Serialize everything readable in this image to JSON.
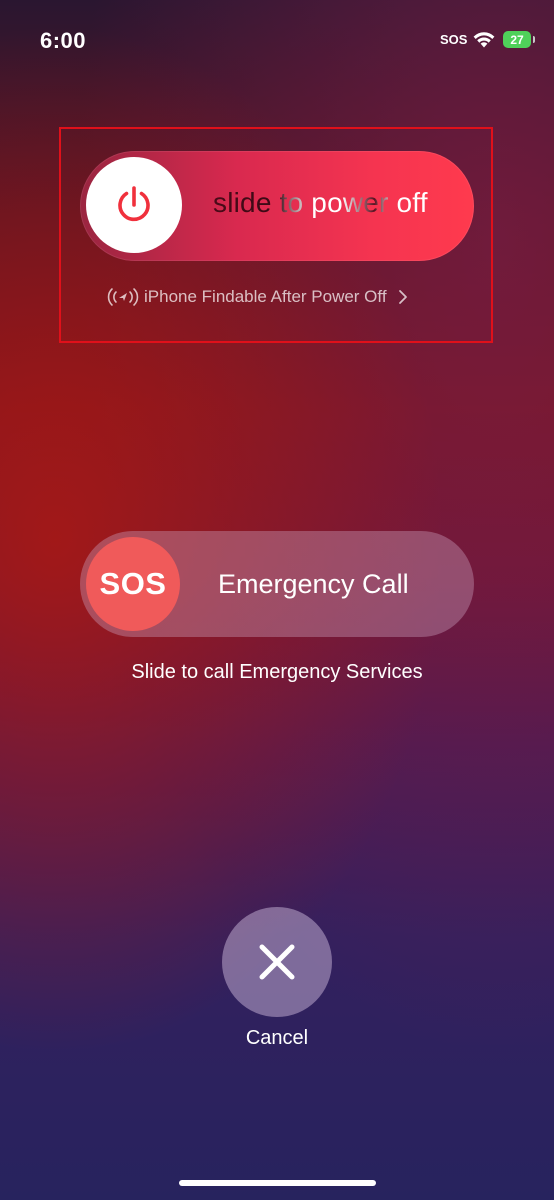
{
  "status_bar": {
    "time": "6:00",
    "sos_indicator": "SOS",
    "wifi_icon": "wifi-icon",
    "battery_level": "27",
    "battery_color": "#4fd15a"
  },
  "power_slider": {
    "label": "slide to power off",
    "knob_icon": "power-icon",
    "knob_icon_color": "#f0303c"
  },
  "findable": {
    "icon": "find-my-signal-icon",
    "text": "iPhone Findable After Power Off",
    "chevron": "chevron-right-icon"
  },
  "emergency_slider": {
    "knob_text": "SOS",
    "label": "Emergency Call",
    "knob_color": "#f05a5a"
  },
  "emergency_hint": "Slide to call Emergency Services",
  "cancel": {
    "icon": "close-icon",
    "label": "Cancel"
  },
  "highlight_color": "#e0101a"
}
